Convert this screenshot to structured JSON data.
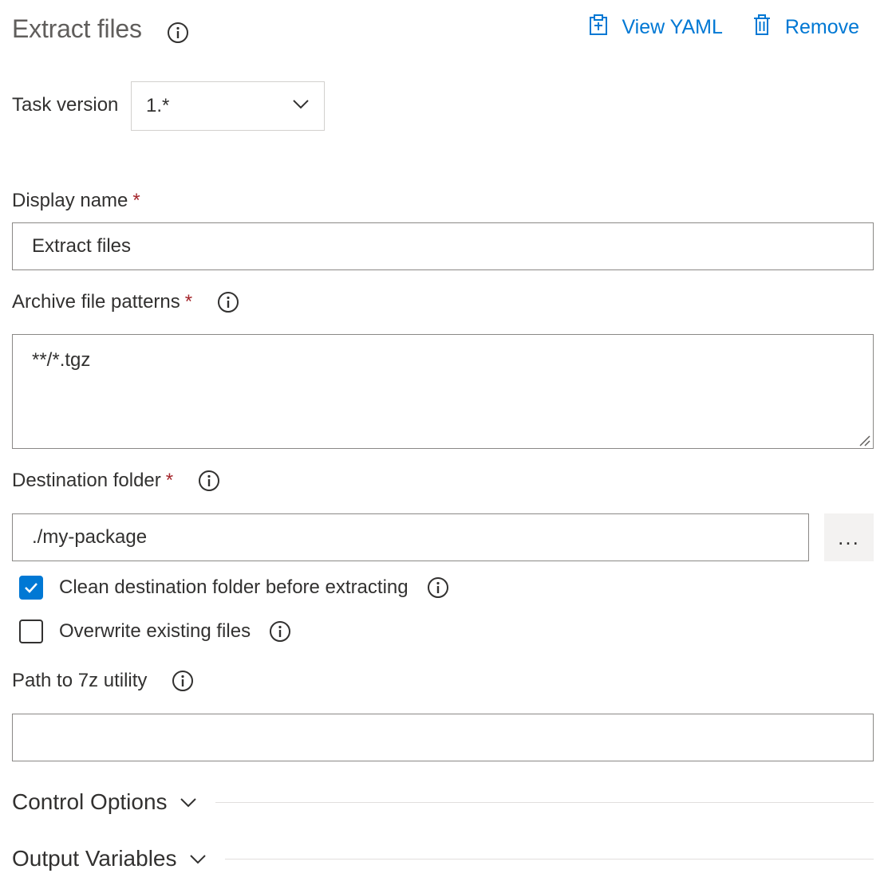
{
  "header": {
    "title": "Extract files",
    "view_yaml_label": "View YAML",
    "remove_label": "Remove"
  },
  "task_version": {
    "label": "Task version",
    "value": "1.*"
  },
  "display_name": {
    "label": "Display name",
    "required_mark": "*",
    "value": "Extract files"
  },
  "archive_patterns": {
    "label": "Archive file patterns",
    "required_mark": "*",
    "value": "**/*.tgz"
  },
  "destination_folder": {
    "label": "Destination folder",
    "required_mark": "*",
    "value": "./my-package",
    "browse_label": "..."
  },
  "options": {
    "clean_destination": {
      "label": "Clean destination folder before extracting",
      "checked": true
    },
    "overwrite_existing": {
      "label": "Overwrite existing files",
      "checked": false
    }
  },
  "path_7z": {
    "label": "Path to 7z utility",
    "value": ""
  },
  "sections": {
    "control_options": "Control Options",
    "output_variables": "Output Variables"
  },
  "colors": {
    "accent": "#0078d4",
    "required": "#a4262c",
    "title": "#605e5c"
  }
}
